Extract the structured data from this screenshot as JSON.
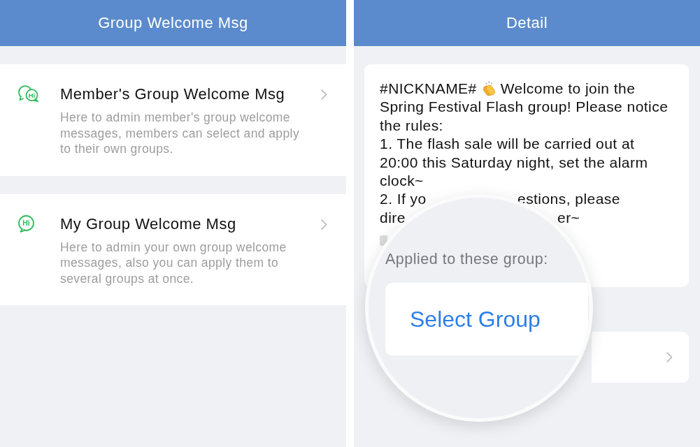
{
  "list_screen": {
    "title": "Group Welcome Msg",
    "items": [
      {
        "kind": "shared",
        "icon_text": "Hi",
        "title": "Member's Group Welcome Msg",
        "description": "Here to admin member's group welcome messages, members can select and apply to their own groups."
      },
      {
        "kind": "own",
        "icon_text": "Hi",
        "title": "My Group Welcome Msg",
        "description": "Here to admin your own group welcome messages, also you can apply them to several groups at once."
      }
    ]
  },
  "detail_screen": {
    "title": "Detail",
    "message": {
      "tag": "#NICKNAME#",
      "lead": "Welcome to join the",
      "body": "Spring Festival Flash group! Please notice the rules:\n1. The flash sale will be carried out at 20:00 this Saturday night, set the alarm clock~",
      "covered_lines": [
        {
          "left": "2. If yo",
          "right": "estions, please"
        },
        {
          "left": "dire",
          "right": "er~"
        }
      ]
    },
    "magnifier": {
      "label": "Applied to these group:",
      "button": "Select Group"
    }
  }
}
